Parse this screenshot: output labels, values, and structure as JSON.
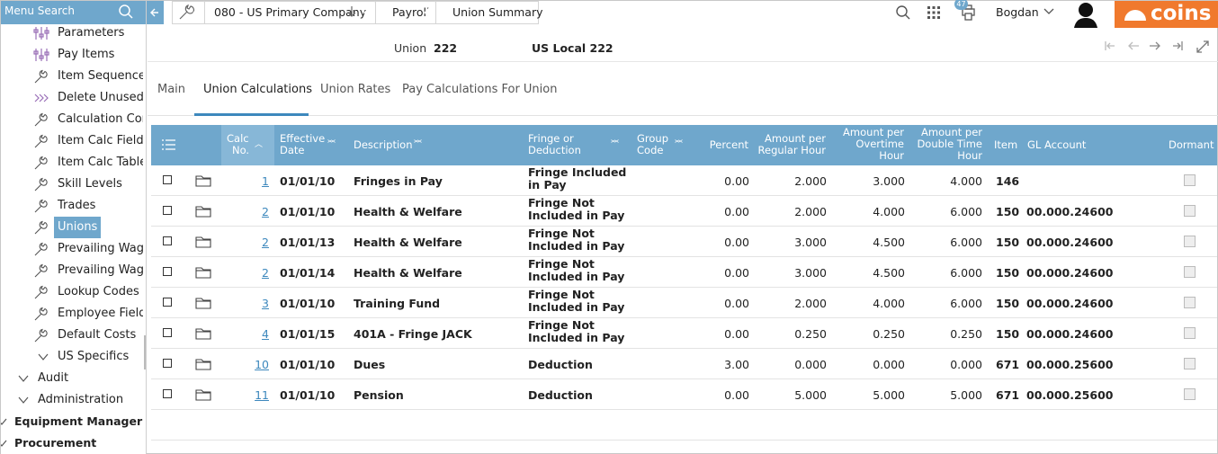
{
  "sidebar": {
    "search_label": "Menu Search",
    "items": [
      {
        "label": "Parameters",
        "icon": "param-icon"
      },
      {
        "label": "Pay Items",
        "icon": "param-icon"
      },
      {
        "label": "Item Sequences",
        "icon": "wrench-icon"
      },
      {
        "label": "Delete Unused",
        "icon": "arrows-icon"
      },
      {
        "label": "Calculation Cons",
        "icon": "wrench-icon"
      },
      {
        "label": "Item Calc Fields",
        "icon": "wrench-icon"
      },
      {
        "label": "Item Calc Tables",
        "icon": "wrench-icon"
      },
      {
        "label": "Skill Levels",
        "icon": "wrench-icon"
      },
      {
        "label": "Trades",
        "icon": "wrench-icon"
      },
      {
        "label": "Unions",
        "icon": "wrench-icon"
      },
      {
        "label": "Prevailing Wage",
        "icon": "wrench-icon"
      },
      {
        "label": "Prevailing Wage",
        "icon": "wrench-icon"
      },
      {
        "label": "Lookup Codes",
        "icon": "wrench-icon"
      },
      {
        "label": "Employee Field",
        "icon": "wrench-icon"
      },
      {
        "label": "Default Costs",
        "icon": "wrench-icon"
      },
      {
        "label": "US Specifics",
        "icon": "chevron-down-icon"
      },
      {
        "label": "Audit",
        "icon": "chevron-down-icon"
      },
      {
        "label": "Administration",
        "icon": "chevron-down-icon"
      },
      {
        "label": "Equipment Manager",
        "icon": "chevron-down-icon"
      },
      {
        "label": "Procurement",
        "icon": "chevron-down-icon"
      }
    ]
  },
  "breadcrumb": {
    "company": "080 - US Primary Company",
    "module": "Payroll",
    "page": "Union Summary"
  },
  "topbar": {
    "print_badge": "47",
    "user_name": "Bogdan",
    "brand": "coins"
  },
  "header": {
    "union_label": "Union",
    "union_code": "222",
    "union_name": "US Local 222"
  },
  "tabs": [
    "Main",
    "Union Calculations",
    "Union Rates",
    "Pay Calculations For Union"
  ],
  "grid": {
    "headers": {
      "calc_no": [
        "Calc",
        "No."
      ],
      "effective_date": [
        "Effective",
        "Date"
      ],
      "description": "Description",
      "fringe": [
        "Fringe or",
        "Deduction"
      ],
      "group_code": [
        "Group",
        "Code"
      ],
      "percent": "Percent",
      "regular": [
        "Amount per",
        "Regular Hour"
      ],
      "overtime": [
        "Amount per",
        "Overtime",
        "Hour"
      ],
      "double": [
        "Amount per",
        "Double Time",
        "Hour"
      ],
      "item": "Item",
      "gl_account": "GL Account",
      "dormant": "Dormant"
    },
    "rows": [
      {
        "calc_no": "1",
        "date": "01/01/10",
        "description": "Fringes in Pay",
        "fringe": "Fringe Included in Pay",
        "percent": "0.00",
        "regular": "2.000",
        "overtime": "3.000",
        "double": "4.000",
        "item": "146",
        "gl": ""
      },
      {
        "calc_no": "2",
        "date": "01/01/10",
        "description": "Health & Welfare",
        "fringe": "Fringe Not Included in Pay",
        "percent": "0.00",
        "regular": "2.000",
        "overtime": "4.000",
        "double": "6.000",
        "item": "150",
        "gl": "00.000.24600"
      },
      {
        "calc_no": "2",
        "date": "01/01/13",
        "description": "Health & Welfare",
        "fringe": "Fringe Not Included in Pay",
        "percent": "0.00",
        "regular": "3.000",
        "overtime": "4.500",
        "double": "6.000",
        "item": "150",
        "gl": "00.000.24600"
      },
      {
        "calc_no": "2",
        "date": "01/01/14",
        "description": "Health & Welfare",
        "fringe": "Fringe Not Included in Pay",
        "percent": "0.00",
        "regular": "3.000",
        "overtime": "4.500",
        "double": "6.000",
        "item": "150",
        "gl": "00.000.24600"
      },
      {
        "calc_no": "3",
        "date": "01/01/10",
        "description": "Training Fund",
        "fringe": "Fringe Not Included in Pay",
        "percent": "0.00",
        "regular": "2.000",
        "overtime": "4.000",
        "double": "6.000",
        "item": "150",
        "gl": "00.000.24600"
      },
      {
        "calc_no": "4",
        "date": "01/01/15",
        "description": "401A - Fringe JACK",
        "fringe": "Fringe Not Included in Pay",
        "percent": "0.00",
        "regular": "0.250",
        "overtime": "0.250",
        "double": "0.250",
        "item": "150",
        "gl": "00.000.24600"
      },
      {
        "calc_no": "10",
        "date": "01/01/10",
        "description": "Dues",
        "fringe": "Deduction",
        "percent": "3.00",
        "regular": "0.000",
        "overtime": "0.000",
        "double": "0.000",
        "item": "671",
        "gl": "00.000.25600"
      },
      {
        "calc_no": "11",
        "date": "01/01/10",
        "description": "Pension",
        "fringe": "Deduction",
        "percent": "0.00",
        "regular": "5.000",
        "overtime": "5.000",
        "double": "5.000",
        "item": "671",
        "gl": "00.000.25600"
      }
    ]
  },
  "colors": {
    "accent": "#6fa7cc",
    "brand": "#f0792d",
    "link": "#3d88bd"
  }
}
